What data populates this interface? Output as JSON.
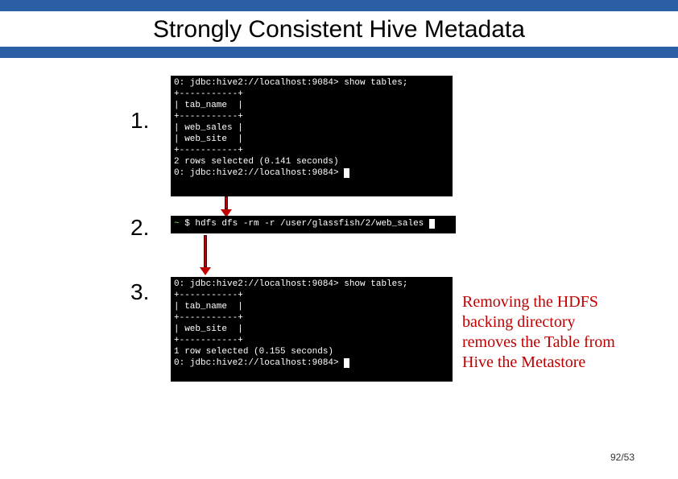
{
  "title": "Strongly Consistent Hive Metadata",
  "steps": {
    "one": "1.",
    "two": "2.",
    "three": "3."
  },
  "terminal1": {
    "line1": "0: jdbc:hive2://localhost:9084> show tables;",
    "rule": "+-----------+",
    "header": "| tab_name  |",
    "row1": "| web_sales |",
    "row2": "| web_site  |",
    "footer": "2 rows selected (0.141 seconds)",
    "prompt": "0: jdbc:hive2://localhost:9084>"
  },
  "terminal2": {
    "user": "~",
    "dollar": "$ ",
    "cmd": "hdfs dfs -rm -r /user/glassfish/2/web_sales"
  },
  "terminal3": {
    "line1": "0: jdbc:hive2://localhost:9084> show tables;",
    "rule": "+-----------+",
    "header": "| tab_name  |",
    "row1": "| web_site  |",
    "footer": "1 row selected (0.155 seconds)",
    "prompt": "0: jdbc:hive2://localhost:9084>"
  },
  "caption": "Removing the HDFS backing directory removes the Table from Hive the Metastore",
  "page_number": "92/53"
}
